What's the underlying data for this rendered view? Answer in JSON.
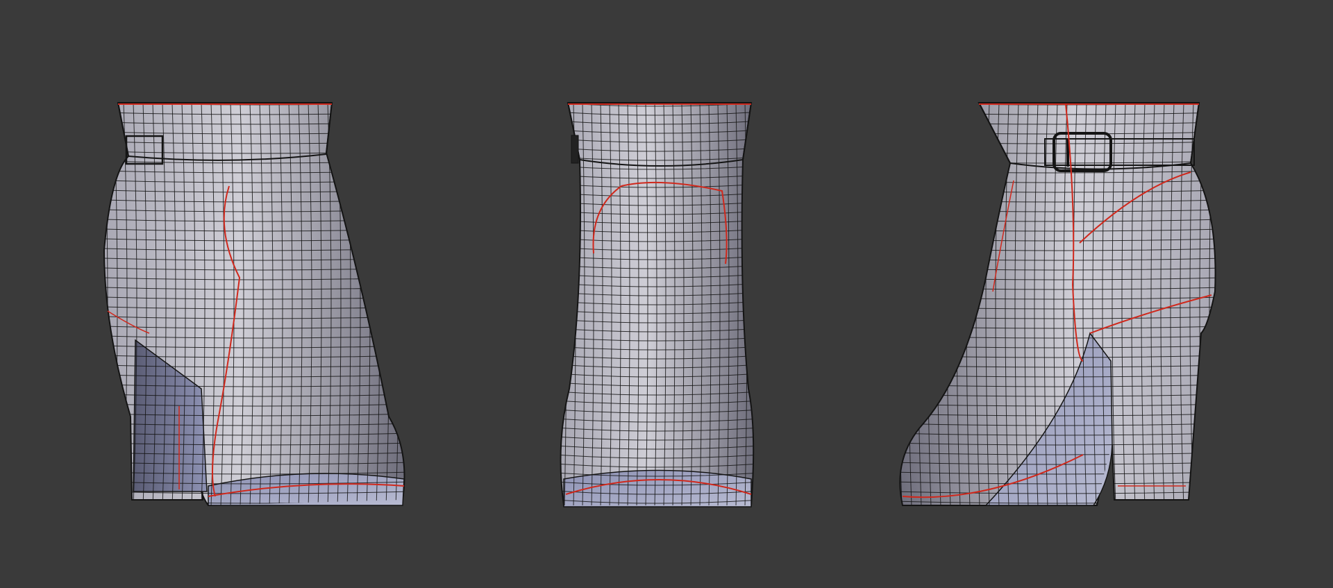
{
  "viewport": {
    "background": "#3a3a3a",
    "views": [
      {
        "id": "side-left",
        "feature": "buckle-strap"
      },
      {
        "id": "front",
        "feature": "none"
      },
      {
        "id": "side-right",
        "feature": "buckle"
      }
    ]
  },
  "mesh_style": {
    "surface_light": "#cfced6",
    "surface_mid": "#a9a8b4",
    "surface_dark": "#6f6e7c",
    "sole_blue": "#8e92b4",
    "wire": "#141414",
    "seam": "#d0281c"
  }
}
